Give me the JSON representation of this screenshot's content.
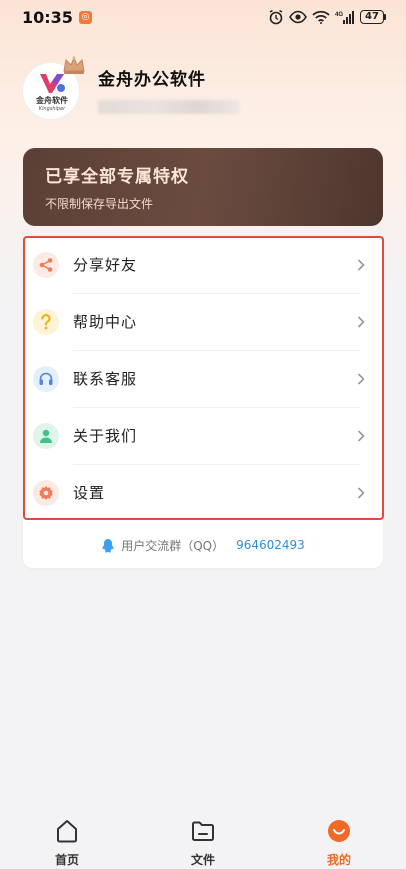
{
  "status_bar": {
    "time": "10:35",
    "network": "4G",
    "battery": "47"
  },
  "profile": {
    "username": "金舟办公软件",
    "avatar_text": "金舟软件",
    "avatar_subtext": "Kingshiper"
  },
  "vip": {
    "title": "已享全部专属特权",
    "subtitle": "不限制保存导出文件"
  },
  "menu": {
    "items": [
      {
        "label": "分享好友",
        "icon": "share-icon",
        "color": "#f07b5b",
        "bg": "#fdeae3"
      },
      {
        "label": "帮助中心",
        "icon": "help-icon",
        "color": "#f2b21b",
        "bg": "#fdf3d7"
      },
      {
        "label": "联系客服",
        "icon": "headset-icon",
        "color": "#4a86e8",
        "bg": "#e4eefc"
      },
      {
        "label": "关于我们",
        "icon": "user-icon",
        "color": "#3cc48a",
        "bg": "#dff5ea"
      },
      {
        "label": "设置",
        "icon": "gear-icon",
        "color": "#f07b5b",
        "bg": "#fdeae3"
      }
    ]
  },
  "qq_group": {
    "label": "用户交流群（QQ）",
    "number": "964602493"
  },
  "bottom_nav": {
    "items": [
      {
        "label": "首页",
        "icon": "home-icon",
        "active": false
      },
      {
        "label": "文件",
        "icon": "folder-icon",
        "active": false
      },
      {
        "label": "我的",
        "icon": "profile-smile-icon",
        "active": true
      }
    ]
  },
  "colors": {
    "accent": "#ef6a27",
    "vip_bg": "#5b3f35",
    "highlight_border": "#e5483f",
    "link": "#2f8fd6"
  }
}
